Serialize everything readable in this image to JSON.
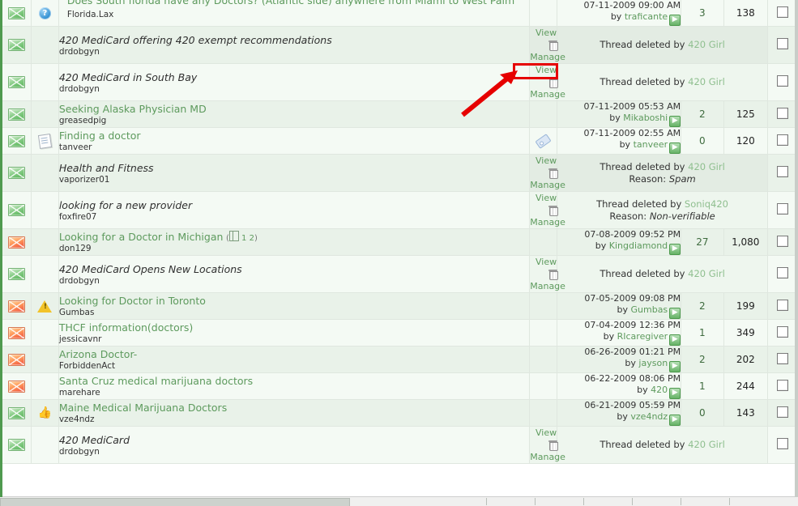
{
  "app": {
    "kind": "forum-thread-moderation-list"
  },
  "colors": {
    "link_green": "#5d9a5d",
    "rail_green": "#4f9a4f",
    "row_light": "#f4faf4",
    "row_dark": "#e9f2e9",
    "annotation_red": "#e60000"
  },
  "labels": {
    "view": "View",
    "manage": "Manage",
    "deleted_prefix": "Thread deleted by",
    "reason_prefix": "Reason:",
    "by_prefix": "by"
  },
  "annotation": {
    "shape": "rectangle-with-arrow",
    "target": "view-link-row-3",
    "color": "#e60000"
  },
  "rows": [
    {
      "id": "row-0",
      "clipped": true,
      "status_icon": "envelope-green-icon",
      "flag_icon": "question-blue-icon",
      "title": "Does South florida have any Doctors? (Atlantic side) anywhere from Miami to West Palm",
      "title_line2": "Florida.Lax",
      "italic": false,
      "starter": "",
      "attach_icon": "",
      "deleted": false,
      "last_post_date": "07-11-2009 09:00 AM",
      "last_post_user": "traficante",
      "replies": "3",
      "views": "138"
    },
    {
      "id": "row-1",
      "status_icon": "envelope-green-icon",
      "flag_icon": "",
      "title": "420 MediCard offering 420 exempt recommendations",
      "italic": true,
      "starter": "drdobgyn",
      "attach_icon": "",
      "deleted": true,
      "deleted_by": "420 Girl",
      "reason": ""
    },
    {
      "id": "row-2",
      "status_icon": "envelope-green-icon",
      "flag_icon": "",
      "title": "420 MediCard in South Bay",
      "italic": true,
      "starter": "drdobgyn",
      "attach_icon": "",
      "deleted": true,
      "deleted_by": "420 Girl",
      "reason": "",
      "annotated": true
    },
    {
      "id": "row-3",
      "status_icon": "envelope-green-icon",
      "flag_icon": "",
      "title": "Seeking Alaska Physician MD",
      "italic": false,
      "starter": "greasedpig",
      "attach_icon": "",
      "deleted": false,
      "last_post_date": "07-11-2009 05:53 AM",
      "last_post_user": "Mikaboshi",
      "replies": "2",
      "views": "125"
    },
    {
      "id": "row-4",
      "status_icon": "envelope-green-icon",
      "flag_icon": "document-icon",
      "title": "Finding a doctor",
      "italic": false,
      "starter": "tanveer",
      "attach_icon": "attachment-tag-icon",
      "deleted": false,
      "last_post_date": "07-11-2009 02:55 AM",
      "last_post_user": "tanveer",
      "replies": "0",
      "views": "120"
    },
    {
      "id": "row-5",
      "status_icon": "envelope-green-icon",
      "flag_icon": "",
      "title": "Health and Fitness",
      "italic": true,
      "starter": "vaporizer01",
      "attach_icon": "",
      "deleted": true,
      "deleted_by": "420 Girl",
      "reason": "Spam"
    },
    {
      "id": "row-6",
      "status_icon": "envelope-green-icon",
      "flag_icon": "",
      "title": "looking for a new provider",
      "italic": true,
      "starter": "foxfire07",
      "attach_icon": "",
      "deleted": true,
      "deleted_by": "Soniq420",
      "reason": "Non-verifiable"
    },
    {
      "id": "row-7",
      "status_icon": "envelope-hot-icon",
      "flag_icon": "",
      "title": "Looking for a Doctor in Michigan",
      "italic": false,
      "pages": [
        "1",
        "2"
      ],
      "starter": "don129",
      "attach_icon": "",
      "deleted": false,
      "last_post_date": "07-08-2009 09:52 PM",
      "last_post_user": "Kingdiamond",
      "replies": "27",
      "views": "1,080"
    },
    {
      "id": "row-8",
      "status_icon": "envelope-green-icon",
      "flag_icon": "",
      "title": "420 MediCard Opens New Locations",
      "italic": true,
      "starter": "drdobgyn",
      "attach_icon": "",
      "deleted": true,
      "deleted_by": "420 Girl",
      "reason": ""
    },
    {
      "id": "row-9",
      "status_icon": "envelope-hot-icon",
      "flag_icon": "warning-icon",
      "title": "Looking for Doctor in Toronto",
      "italic": false,
      "starter": "Gumbas",
      "attach_icon": "",
      "deleted": false,
      "last_post_date": "07-05-2009 09:08 PM",
      "last_post_user": "Gumbas",
      "replies": "2",
      "views": "199"
    },
    {
      "id": "row-10",
      "status_icon": "envelope-hot-icon",
      "flag_icon": "",
      "title": "THCF information(doctors)",
      "italic": false,
      "starter": "jessicavnr",
      "attach_icon": "",
      "deleted": false,
      "last_post_date": "07-04-2009 12:36 PM",
      "last_post_user": "RIcaregiver",
      "replies": "1",
      "views": "349"
    },
    {
      "id": "row-11",
      "status_icon": "envelope-hot-icon",
      "flag_icon": "",
      "title": "Arizona Doctor-",
      "italic": false,
      "starter": "ForbiddenAct",
      "attach_icon": "",
      "deleted": false,
      "last_post_date": "06-26-2009 01:21 PM",
      "last_post_user": "jayson",
      "replies": "2",
      "views": "202"
    },
    {
      "id": "row-12",
      "status_icon": "envelope-hot-icon",
      "flag_icon": "",
      "title": "Santa Cruz medical marijuana doctors",
      "italic": false,
      "starter": "marehare",
      "attach_icon": "",
      "deleted": false,
      "last_post_date": "06-22-2009 08:06 PM",
      "last_post_user": "420",
      "replies": "1",
      "views": "244"
    },
    {
      "id": "row-13",
      "status_icon": "envelope-green-icon",
      "flag_icon": "thumbs-up-icon",
      "title": "Maine Medical Marijuana Doctors",
      "italic": false,
      "starter": "vze4ndz",
      "attach_icon": "",
      "deleted": false,
      "last_post_date": "06-21-2009 05:59 PM",
      "last_post_user": "vze4ndz",
      "replies": "0",
      "views": "143"
    },
    {
      "id": "row-14",
      "status_icon": "envelope-green-icon",
      "flag_icon": "",
      "title": "420 MediCard",
      "italic": true,
      "starter": "drdobgyn",
      "attach_icon": "",
      "deleted": true,
      "deleted_by": "420 Girl",
      "reason": ""
    }
  ]
}
